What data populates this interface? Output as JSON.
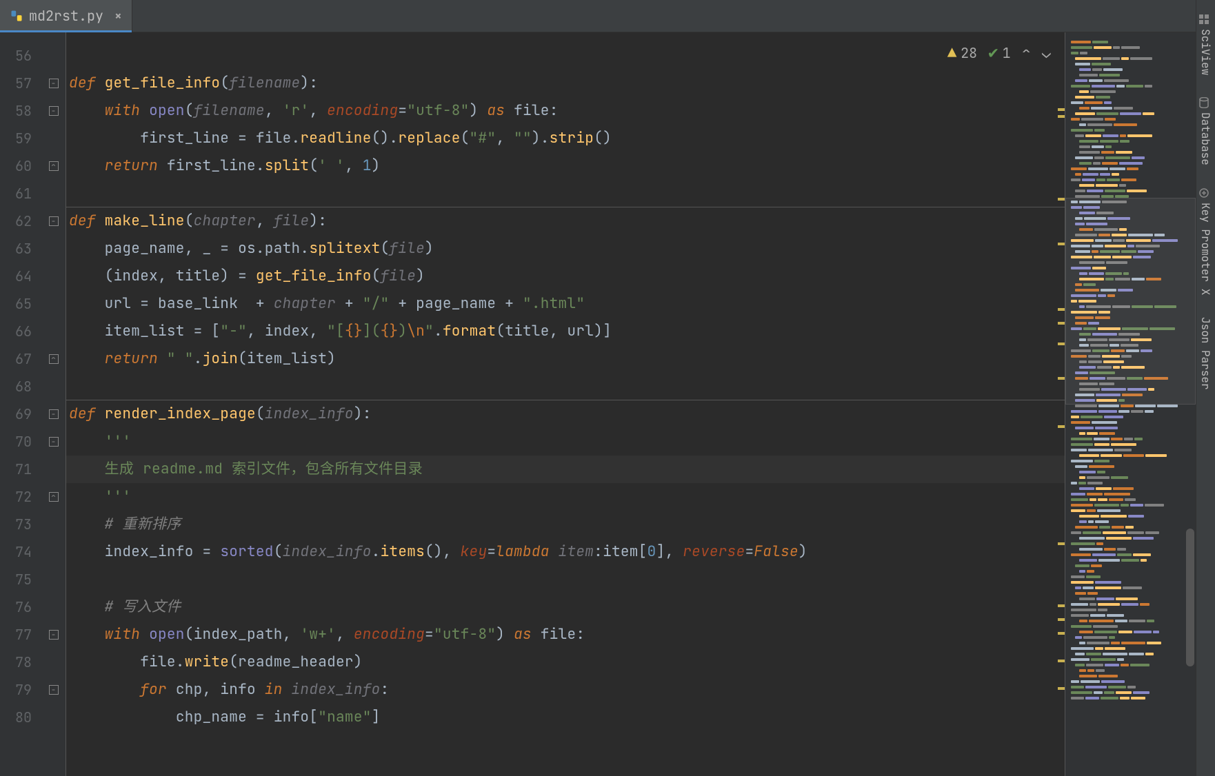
{
  "tab": {
    "filename": "md2rst.py",
    "close_label": "×"
  },
  "inspection": {
    "warnings": "28",
    "passes": "1"
  },
  "lines": {
    "start": 56,
    "end": 80,
    "highlighted": 71
  },
  "code": {
    "l57_def": "def ",
    "l57_fn": "get_file_info",
    "l57_open": "(",
    "l57_p1": "filename",
    "l57_close": "):",
    "l58_with": "with ",
    "l58_open": "open",
    "l58_a": "(",
    "l58_p1": "filename",
    "l58_c1": ", ",
    "l58_s1": "'r'",
    "l58_c2": ", ",
    "l58_kw": "encoding",
    "l58_eq": "=",
    "l58_s2": "\"utf-8\"",
    "l58_b": ") ",
    "l58_as": "as ",
    "l58_file": "file:",
    "l59_a": "first_line = file.",
    "l59_fn1": "readline",
    "l59_b": "().",
    "l59_fn2": "replace",
    "l59_c": "(",
    "l59_s1": "\"#\"",
    "l59_d": ", ",
    "l59_s2": "\"\"",
    "l59_e": ").",
    "l59_fn3": "strip",
    "l59_f": "()",
    "l60_ret": "return ",
    "l60_a": "first_line.",
    "l60_fn": "split",
    "l60_b": "(",
    "l60_s": "' '",
    "l60_c": ", ",
    "l60_n": "1",
    "l60_d": ")",
    "l62_def": "def ",
    "l62_fn": "make_line",
    "l62_a": "(",
    "l62_p1": "chapter",
    "l62_c": ", ",
    "l62_p2": "file",
    "l62_b": "):",
    "l63_a": "page_name, _ = os.path.",
    "l63_fn": "splitext",
    "l63_b": "(",
    "l63_p": "file",
    "l63_c": ")",
    "l64_a": "(index, title) = ",
    "l64_fn": "get_file_info",
    "l64_b": "(",
    "l64_p": "file",
    "l64_c": ")",
    "l65_a": "url = base_link  + ",
    "l65_p": "chapter ",
    "l65_b": "+ ",
    "l65_s1": "\"/\" ",
    "l65_c": "+ page_name + ",
    "l65_s2": "\".html\"",
    "l66_a": "item_list = [",
    "l66_s1": "\"-\"",
    "l66_b": ", index, ",
    "l66_s2a": "\"[",
    "l66_e1": "{}",
    "l66_s2b": "](",
    "l66_e2": "{}",
    "l66_s2c": ")",
    "l66_e3": "\\n",
    "l66_s2d": "\"",
    "l66_c": ".",
    "l66_fn": "format",
    "l66_d": "(title, url)]",
    "l67_ret": "return ",
    "l67_s": "\" \"",
    "l67_a": ".",
    "l67_fn": "join",
    "l67_b": "(item_list)",
    "l69_def": "def ",
    "l69_fn": "render_index_page",
    "l69_a": "(",
    "l69_p": "index_info",
    "l69_b": "):",
    "l70_doc": "'''",
    "l71_doc": "生成 readme.md 索引文件，包含所有文件目录",
    "l72_doc": "'''",
    "l73_c": "# 重新排序",
    "l74_a": "index_info = ",
    "l74_fn": "sorted",
    "l74_b": "(",
    "l74_p": "index_info",
    "l74_c": ".",
    "l74_fn2": "items",
    "l74_d": "(), ",
    "l74_kw": "key",
    "l74_e": "=",
    "l74_lam": "lambda ",
    "l74_pi": "item",
    "l74_f": ":item[",
    "l74_n": "0",
    "l74_g": "], ",
    "l74_kw2": "reverse",
    "l74_h": "=",
    "l74_false": "False",
    "l74_i": ")",
    "l76_c": "# 写入文件",
    "l77_with": "with ",
    "l77_open": "open",
    "l77_a": "(index_path, ",
    "l77_s1": "'w+'",
    "l77_b": ", ",
    "l77_kw": "encoding",
    "l77_c": "=",
    "l77_s2": "\"utf-8\"",
    "l77_d": ") ",
    "l77_as": "as ",
    "l77_e": "file:",
    "l78_a": "file.",
    "l78_fn": "write",
    "l78_b": "(readme_header)",
    "l79_for": "for ",
    "l79_a": "chp, info ",
    "l79_in": "in ",
    "l79_p": "index_info",
    "l79_b": ":",
    "l80_a": "chp_name = info[",
    "l80_s": "\"name\"",
    "l80_b": "]"
  },
  "right_strip": {
    "sciview": "SciView",
    "database": "Database",
    "keypromoter": "Key Promoter X",
    "jsonparser": "Json Parser"
  }
}
